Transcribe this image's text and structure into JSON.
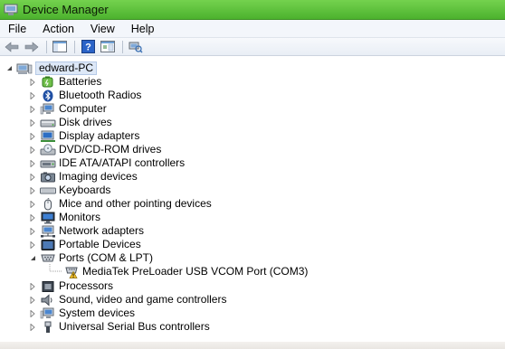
{
  "window": {
    "title": "Device Manager"
  },
  "menu": [
    "File",
    "Action",
    "View",
    "Help"
  ],
  "toolbar": {
    "icons": [
      "back-arrow-icon",
      "forward-arrow-icon",
      "show-hide-console-tree-icon",
      "help-icon",
      "properties-icon",
      "scan-hardware-icon"
    ]
  },
  "tree": {
    "root": "edward-PC",
    "categories": [
      {
        "label": "Batteries",
        "icon": "battery-icon"
      },
      {
        "label": "Bluetooth Radios",
        "icon": "bluetooth-icon"
      },
      {
        "label": "Computer",
        "icon": "computer-icon"
      },
      {
        "label": "Disk drives",
        "icon": "disk-drive-icon"
      },
      {
        "label": "Display adapters",
        "icon": "display-adapter-icon"
      },
      {
        "label": "DVD/CD-ROM drives",
        "icon": "dvd-drive-icon"
      },
      {
        "label": "IDE ATA/ATAPI controllers",
        "icon": "ide-controller-icon"
      },
      {
        "label": "Imaging devices",
        "icon": "camera-icon"
      },
      {
        "label": "Keyboards",
        "icon": "keyboard-icon"
      },
      {
        "label": "Mice and other pointing devices",
        "icon": "mouse-icon"
      },
      {
        "label": "Monitors",
        "icon": "monitor-icon"
      },
      {
        "label": "Network adapters",
        "icon": "network-adapter-icon"
      },
      {
        "label": "Portable Devices",
        "icon": "portable-device-icon"
      },
      {
        "label": "Ports (COM & LPT)",
        "icon": "port-icon",
        "expanded": true,
        "children": [
          {
            "label": "MediaTek PreLoader USB VCOM Port (COM3)",
            "icon": "warning-port-icon"
          }
        ]
      },
      {
        "label": "Processors",
        "icon": "processor-icon"
      },
      {
        "label": "Sound, video and game controllers",
        "icon": "sound-icon"
      },
      {
        "label": "System devices",
        "icon": "system-device-icon"
      },
      {
        "label": "Universal Serial Bus controllers",
        "icon": "usb-icon"
      }
    ]
  },
  "colors": {
    "titlebar": "#5cc23a",
    "selection": "#dde8f7"
  }
}
